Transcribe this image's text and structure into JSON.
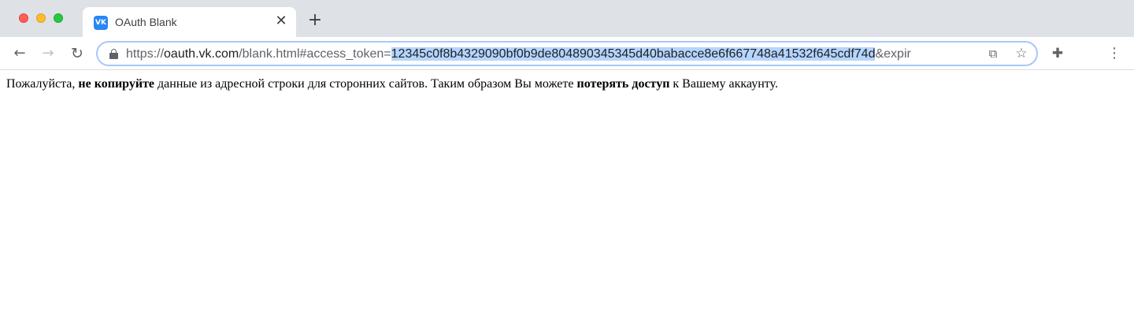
{
  "window": {
    "traffic_lights": [
      "close",
      "minimize",
      "zoom"
    ]
  },
  "tab": {
    "favicon_text": "VK",
    "favicon_color": "#2787f5",
    "title": "OAuth Blank",
    "close_glyph": "✕"
  },
  "new_tab_glyph": "+",
  "toolbar": {
    "back_glyph": "←",
    "forward_glyph": "→",
    "reload_glyph": "↻",
    "cast_glyph": "⧉",
    "star_glyph": "☆",
    "extensions_glyph": "✚",
    "menu_glyph": "⋮"
  },
  "address_bar": {
    "scheme": "https://",
    "host": "oauth.vk.com",
    "path": "/blank.html#access_token=",
    "token": "12345c0f8b4329090bf0b9de804890345345d40babacce8e6f667748a41532f645cdf74d",
    "suffix": "&expir",
    "selection_color": "#b4d5fe"
  },
  "page": {
    "text_1": "Пожалуйста, ",
    "bold_1": "не копируйте",
    "text_2": " данные из адресной строки для сторонних сайтов. Таким образом Вы можете ",
    "bold_2": "потерять доступ",
    "text_3": " к Вашему аккаунту."
  }
}
